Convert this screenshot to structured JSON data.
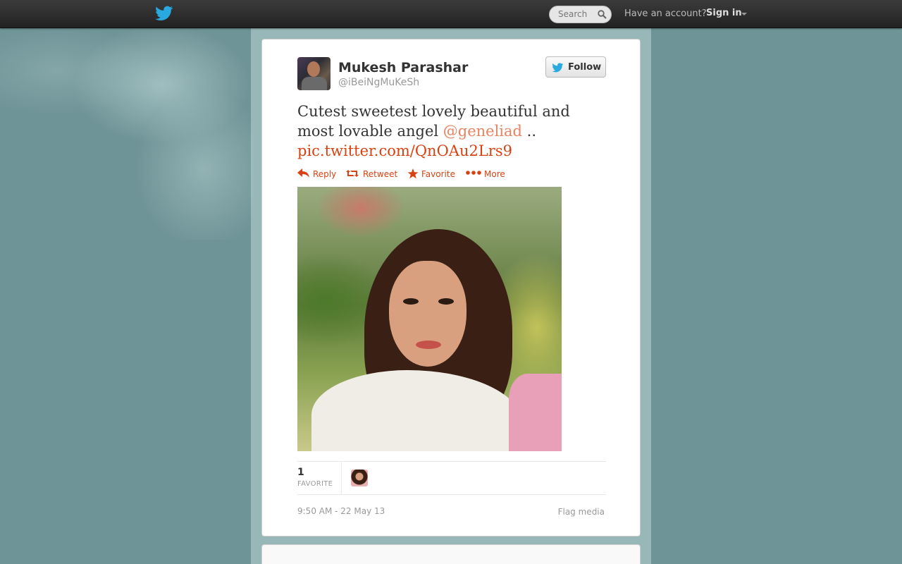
{
  "topbar": {
    "search_placeholder": "Search",
    "have_account": "Have an account?",
    "signin_label": "Sign in"
  },
  "tweet": {
    "display_name": "Mukesh Parashar",
    "screen_name": "@iBeiNgMuKeSh",
    "follow_label": "Follow",
    "text_before": "Cutest sweetest lovely beautiful and most lovable angel ",
    "mention": "@geneliad",
    "text_mid": "  .. ",
    "link": "pic.twitter.com/QnOAu2Lrs9",
    "actions": {
      "reply": "Reply",
      "retweet": "Retweet",
      "favorite": "Favorite",
      "more": "More"
    },
    "stats": {
      "favorite_count": "1",
      "favorite_label": "FAVORITE"
    },
    "timestamp": "9:50 AM - 22 May 13",
    "flag_media": "Flag media"
  },
  "colors": {
    "page_bg": "#6f9497",
    "link": "#d84212",
    "mention": "#e9835f",
    "twitter_blue": "#2aa9e0"
  },
  "icons": [
    "twitter-bird-icon",
    "search-icon",
    "caret-down-icon",
    "reply-icon",
    "retweet-icon",
    "star-icon",
    "more-dots-icon"
  ]
}
